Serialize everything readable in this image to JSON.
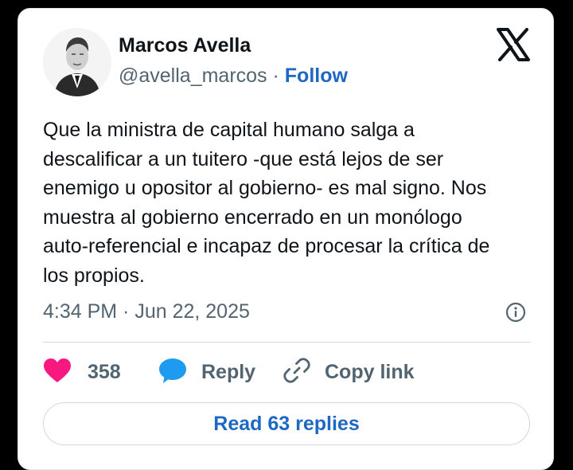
{
  "author": {
    "name": "Marcos Avella",
    "handle": "@avella_marcos",
    "separator": " · ",
    "follow_label": "Follow"
  },
  "tweet": {
    "lines": [
      "Que la ministra de capital humano salga a",
      "descalificar a un tuitero -que está lejos de ser",
      "enemigo u opositor al gobierno- es mal signo. Nos",
      "muestra al gobierno encerrado en un monólogo",
      "auto-referencial e incapaz de procesar la crítica de",
      "los propios."
    ],
    "timestamp": "4:34 PM · Jun 22, 2025"
  },
  "actions": {
    "like_count": "358",
    "reply_label": "Reply",
    "copy_label": "Copy link"
  },
  "footer": {
    "read_replies_label": "Read 63 replies"
  },
  "icons": {
    "brand": "x-logo-icon",
    "info": "info-icon",
    "like": "heart-icon",
    "reply": "speech-bubble-icon",
    "copy": "link-icon"
  },
  "colors": {
    "accent": "#1d68c4",
    "like": "#f91880",
    "reply": "#1d9bf0",
    "muted_text": "#536471",
    "text": "#0f1419"
  }
}
